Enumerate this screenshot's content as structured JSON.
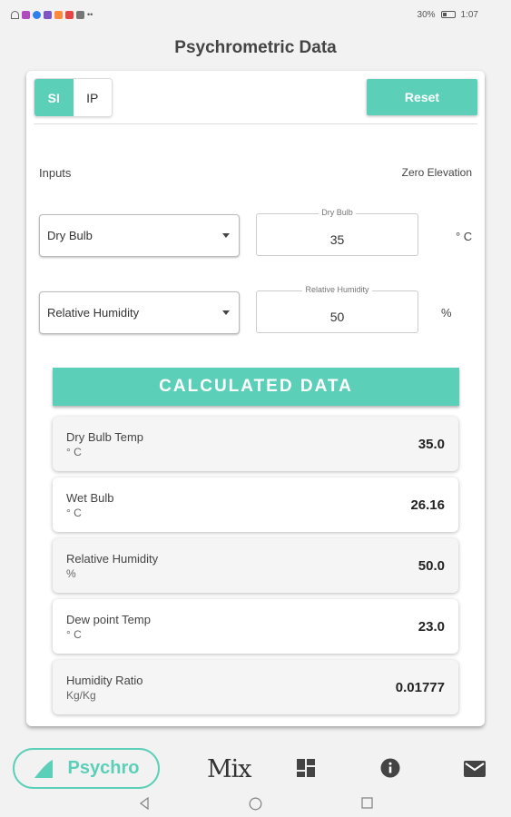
{
  "status_bar": {
    "battery_percent": "30%",
    "time": "1:07"
  },
  "page": {
    "title": "Psychrometric Data"
  },
  "units": {
    "si_label": "SI",
    "ip_label": "IP",
    "selected": "SI"
  },
  "reset_label": "Reset",
  "inputs": {
    "section_label": "Inputs",
    "elevation_label": "Zero Elevation",
    "rows": [
      {
        "select_value": "Dry Bulb",
        "field_label": "Dry Bulb",
        "field_value": "35",
        "unit": "° C"
      },
      {
        "select_value": "Relative Humidity",
        "field_label": "Relative Humidity",
        "field_value": "50",
        "unit": "%"
      }
    ]
  },
  "calculated": {
    "header": "CALCULATED DATA",
    "rows": [
      {
        "name": "Dry Bulb Temp",
        "unit": "° C",
        "value": "35.0"
      },
      {
        "name": "Wet Bulb",
        "unit": "° C",
        "value": "26.16"
      },
      {
        "name": "Relative Humidity",
        "unit": "%",
        "value": "50.0"
      },
      {
        "name": "Dew point Temp",
        "unit": "° C",
        "value": "23.0"
      },
      {
        "name": "Humidity Ratio",
        "unit": "Kg/Kg",
        "value": "0.01777"
      }
    ]
  },
  "bottom_nav": {
    "psychro_label": "Psychro",
    "mix_label": "Mix",
    "items": [
      "psychro",
      "mix",
      "dashboard-icon",
      "info-icon",
      "mail-icon"
    ]
  },
  "colors": {
    "accent": "#5ccfb9",
    "background": "#f2f2f2"
  }
}
